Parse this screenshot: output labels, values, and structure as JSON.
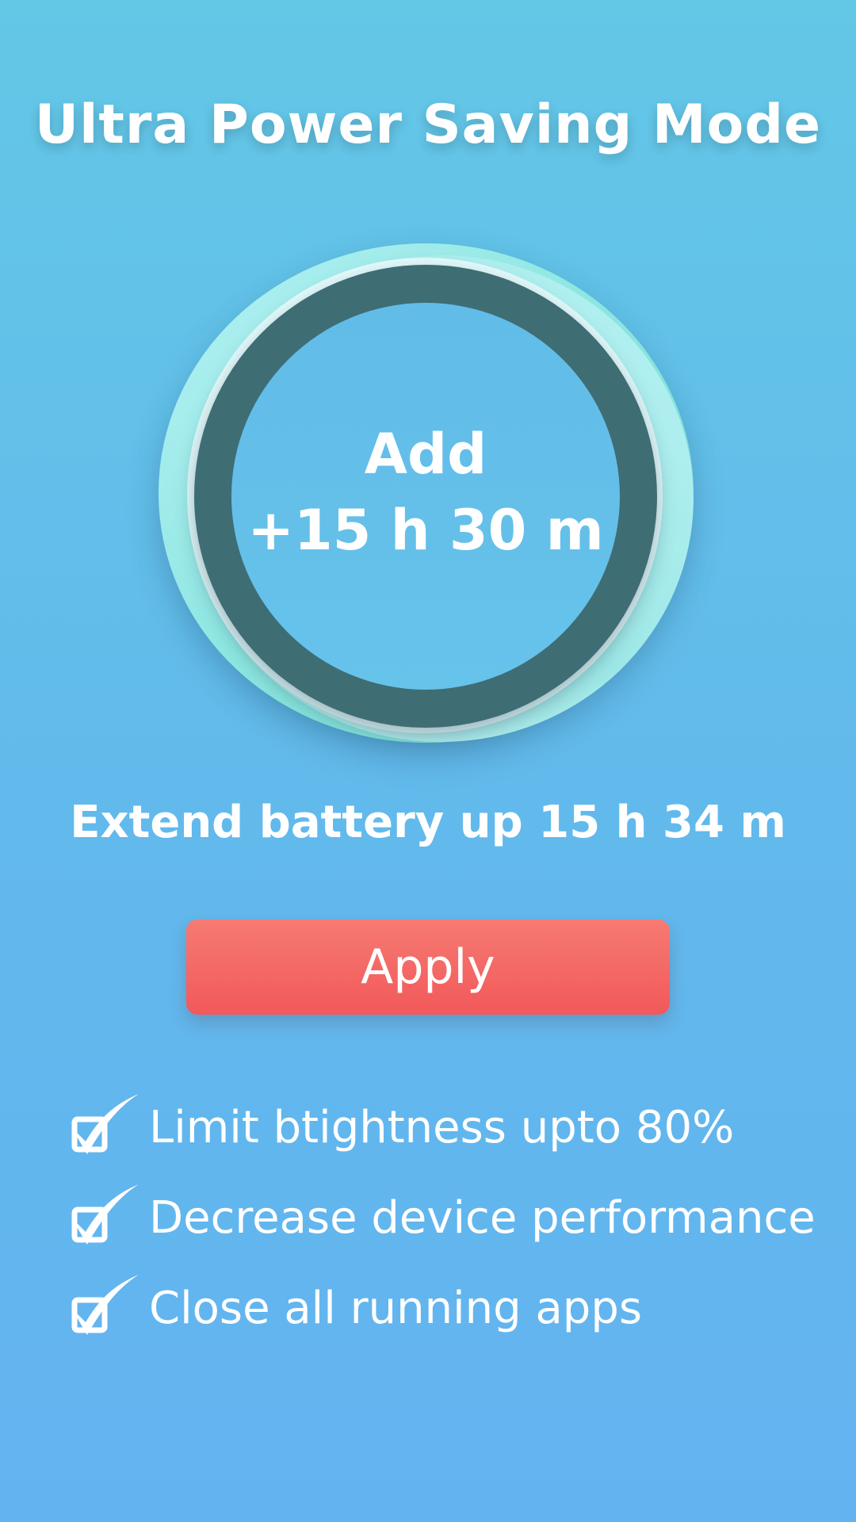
{
  "header": {
    "title": "Ultra Power Saving Mode"
  },
  "dial": {
    "label": "Add",
    "value": "+15 h 30 m"
  },
  "extend_text": "Extend battery up 15 h 34 m",
  "apply_button": {
    "label": "Apply"
  },
  "features": [
    {
      "label": "Limit btightness upto 80%",
      "icon": "checkbox-checked-icon"
    },
    {
      "label": "Decrease device performance",
      "icon": "checkbox-checked-icon"
    },
    {
      "label": "Close all running apps",
      "icon": "checkbox-checked-icon"
    }
  ],
  "colors": {
    "background_top": "#63c7e6",
    "background_bottom": "#63b3f0",
    "ring_dark": "#3f6d74",
    "disc_accent": "#8fe7e2",
    "apply_button": "#f2585a",
    "text": "#ffffff"
  }
}
